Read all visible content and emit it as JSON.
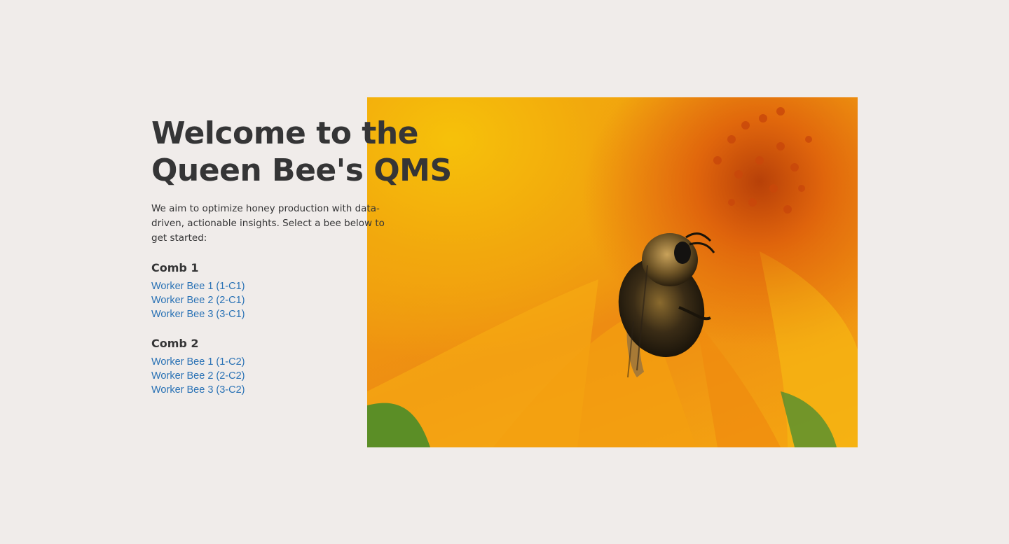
{
  "hero": {
    "title": "Welcome to the Queen Bee's QMS",
    "intro": "We aim to optimize honey production with data-driven, actionable insights. Select a bee below to get started:"
  },
  "combs": [
    {
      "title": "Comb 1",
      "bees": [
        {
          "label": "Worker Bee 1 (1-C1)"
        },
        {
          "label": "Worker Bee 2 (2-C1)"
        },
        {
          "label": "Worker Bee 3 (3-C1)"
        }
      ]
    },
    {
      "title": "Comb 2",
      "bees": [
        {
          "label": "Worker Bee 1 (1-C2)"
        },
        {
          "label": "Worker Bee 2 (2-C2)"
        },
        {
          "label": "Worker Bee 3 (3-C2)"
        }
      ]
    }
  ],
  "image": {
    "subject": "bee-on-sunflower-photo"
  },
  "colors": {
    "background": "#f0ecea",
    "text": "#353536",
    "link": "#2a72b5"
  }
}
